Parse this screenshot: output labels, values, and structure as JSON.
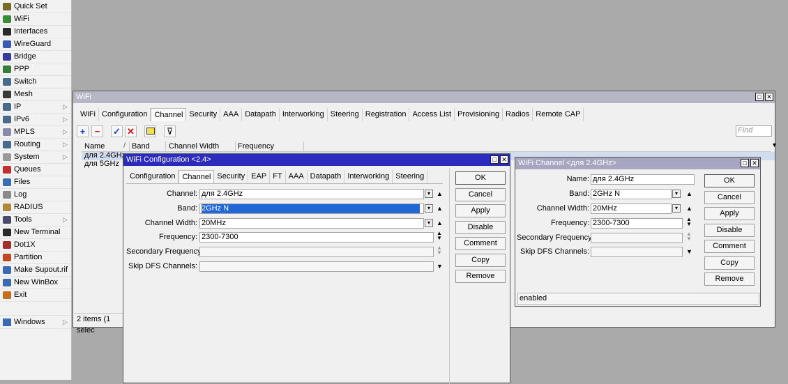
{
  "sidebar": {
    "items": [
      {
        "label": "Quick Set",
        "icon": "quick-set-icon",
        "submenu": false
      },
      {
        "label": "WiFi",
        "icon": "wifi-icon",
        "submenu": false
      },
      {
        "label": "Interfaces",
        "icon": "interfaces-icon",
        "submenu": false
      },
      {
        "label": "WireGuard",
        "icon": "wireguard-icon",
        "submenu": false
      },
      {
        "label": "Bridge",
        "icon": "bridge-icon",
        "submenu": false
      },
      {
        "label": "PPP",
        "icon": "ppp-icon",
        "submenu": false
      },
      {
        "label": "Switch",
        "icon": "switch-icon",
        "submenu": false
      },
      {
        "label": "Mesh",
        "icon": "mesh-icon",
        "submenu": false
      },
      {
        "label": "IP",
        "icon": "ip-icon",
        "submenu": true
      },
      {
        "label": "IPv6",
        "icon": "ipv6-icon",
        "submenu": true
      },
      {
        "label": "MPLS",
        "icon": "mpls-icon",
        "submenu": true
      },
      {
        "label": "Routing",
        "icon": "routing-icon",
        "submenu": true
      },
      {
        "label": "System",
        "icon": "system-icon",
        "submenu": true
      },
      {
        "label": "Queues",
        "icon": "queues-icon",
        "submenu": false
      },
      {
        "label": "Files",
        "icon": "files-icon",
        "submenu": false
      },
      {
        "label": "Log",
        "icon": "log-icon",
        "submenu": false
      },
      {
        "label": "RADIUS",
        "icon": "radius-icon",
        "submenu": false
      },
      {
        "label": "Tools",
        "icon": "tools-icon",
        "submenu": true
      },
      {
        "label": "New Terminal",
        "icon": "terminal-icon",
        "submenu": false
      },
      {
        "label": "Dot1X",
        "icon": "dot1x-icon",
        "submenu": false
      },
      {
        "label": "Partition",
        "icon": "partition-icon",
        "submenu": false
      },
      {
        "label": "Make Supout.rif",
        "icon": "supout-icon",
        "submenu": false
      },
      {
        "label": "New WinBox",
        "icon": "winbox-icon",
        "submenu": false
      },
      {
        "label": "Exit",
        "icon": "exit-icon",
        "submenu": false
      }
    ],
    "windows_label": "Windows"
  },
  "wifi_window": {
    "title": "WiFi",
    "tabs": [
      "WiFi",
      "Configuration",
      "Channel",
      "Security",
      "AAA",
      "Datapath",
      "Interworking",
      "Steering",
      "Registration",
      "Access List",
      "Provisioning",
      "Radios",
      "Remote CAP"
    ],
    "active_tab": "Channel",
    "find_placeholder": "Find",
    "columns": [
      "Name",
      "Band",
      "Channel Width",
      "Frequency"
    ],
    "rows": [
      {
        "name": "для 2.4GHz"
      },
      {
        "name": "для 5GHz"
      }
    ],
    "status": "2 items (1 selec"
  },
  "config_window": {
    "title": "WiFi Configuration <2.4>",
    "tabs": [
      "Configuration",
      "Channel",
      "Security",
      "EAP",
      "FT",
      "AAA",
      "Datapath",
      "Interworking",
      "Steering"
    ],
    "active_tab": "Channel",
    "fields": {
      "channel": {
        "label": "Channel:",
        "value": "для 2.4GHz"
      },
      "band": {
        "label": "Band:",
        "value": "2GHz N"
      },
      "width": {
        "label": "Channel Width:",
        "value": "20MHz"
      },
      "frequency": {
        "label": "Frequency:",
        "value": "2300-7300"
      },
      "secondary": {
        "label": "Secondary Frequency:",
        "value": ""
      },
      "skipdfs": {
        "label": "Skip DFS Channels:",
        "value": ""
      }
    },
    "buttons": [
      "OK",
      "Cancel",
      "Apply",
      "Disable",
      "Comment",
      "Copy",
      "Remove"
    ]
  },
  "channel_window": {
    "title": "WiFi Channel <для 2.4GHz>",
    "fields": {
      "name": {
        "label": "Name:",
        "value": "для 2.4GHz"
      },
      "band": {
        "label": "Band:",
        "value": "2GHz N"
      },
      "width": {
        "label": "Channel Width:",
        "value": "20MHz"
      },
      "frequency": {
        "label": "Frequency:",
        "value": "2300-7300"
      },
      "secondary": {
        "label": "Secondary Frequency:",
        "value": ""
      },
      "skipdfs": {
        "label": "Skip DFS Channels:",
        "value": ""
      }
    },
    "buttons": [
      "OK",
      "Cancel",
      "Apply",
      "Disable",
      "Comment",
      "Copy",
      "Remove"
    ],
    "status": "enabled"
  },
  "colors": {
    "titlebar_active": "#2b2bbd",
    "titlebar_inactive": "#a0a0b8",
    "selection": "#2267d6",
    "row_selected": "#d2dcef"
  }
}
